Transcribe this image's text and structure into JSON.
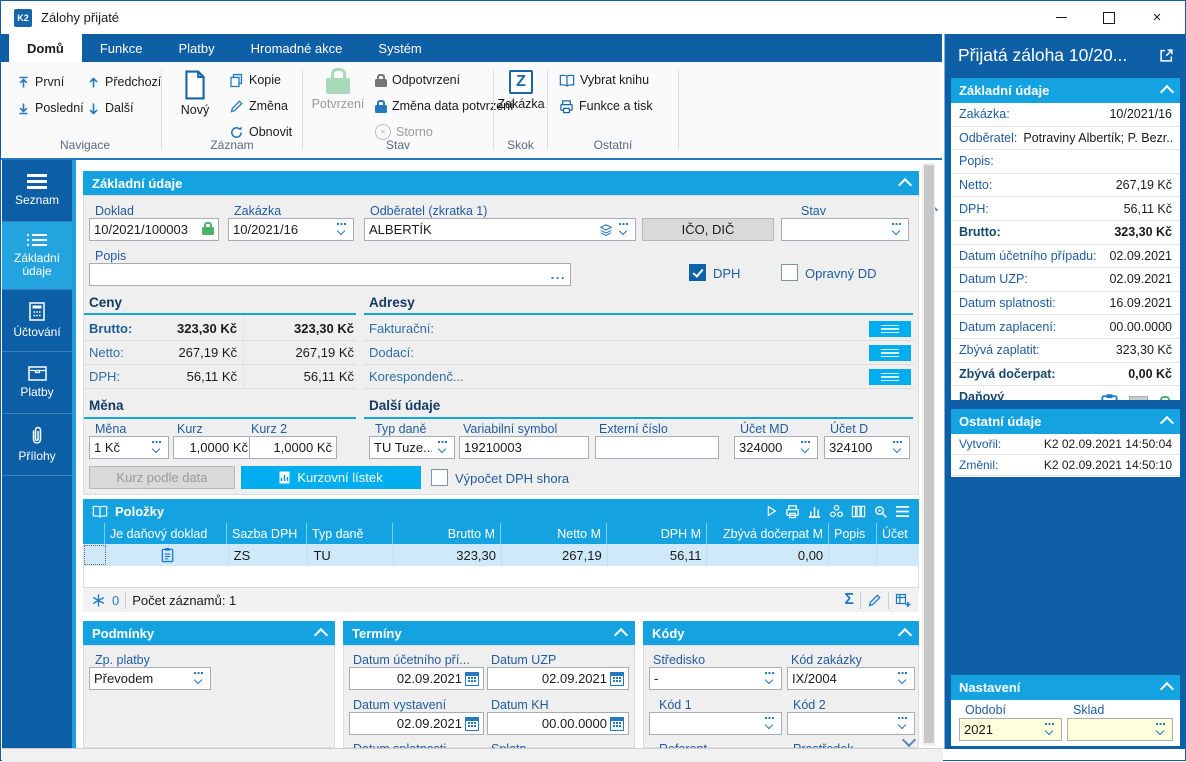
{
  "window": {
    "title": "Zálohy přijaté"
  },
  "tabs": {
    "items": [
      "Domů",
      "Funkce",
      "Platby",
      "Hromadné akce",
      "Systém"
    ],
    "active": "Domů"
  },
  "ribbon": {
    "navigace": {
      "label": "Navigace",
      "prvni": "První",
      "posledni": "Poslední",
      "predchozi": "Předchozí",
      "dalsi": "Další"
    },
    "zaznam": {
      "label": "Záznam",
      "novy": "Nový",
      "kopie": "Kopie",
      "zmena": "Změna",
      "obnovit": "Obnovit"
    },
    "stav": {
      "label": "Stav",
      "potvrzeni": "Potvrzení",
      "odpotvrzeni": "Odpotvrzení",
      "zmena_data": "Změna data potvrzení",
      "storno": "Storno"
    },
    "skok": {
      "label": "Skok",
      "zakazka": "Zakázka"
    },
    "ostatni": {
      "label": "Ostatní",
      "vybrat_knihu": "Vybrat knihu",
      "funkce_a_tisk": "Funkce a tisk"
    }
  },
  "sidebar": {
    "items": [
      {
        "label": "Seznam",
        "icon": "menu-icon"
      },
      {
        "label": "Základní údaje",
        "icon": "list-icon",
        "active": true
      },
      {
        "label": "Účtování",
        "icon": "calculator-icon"
      },
      {
        "label": "Platby",
        "icon": "drawer-icon"
      },
      {
        "label": "Přílohy",
        "icon": "paperclip-icon"
      }
    ]
  },
  "form": {
    "section_title": "Základní údaje",
    "doklad": {
      "label": "Doklad",
      "value": "10/2021/100003"
    },
    "zakazka": {
      "label": "Zakázka",
      "value": "10/2021/16"
    },
    "odberatel": {
      "label": "Odběratel (zkratka 1)",
      "value": "ALBERTÍK"
    },
    "ico_dic_button": "IČO, DIČ",
    "stav": {
      "label": "Stav",
      "value": ""
    },
    "popis": {
      "label": "Popis",
      "value": "",
      "more": "..."
    },
    "dph": {
      "label": "DPH",
      "checked": true
    },
    "opravny_dd": {
      "label": "Opravný DD",
      "checked": false
    },
    "ceny": {
      "title": "Ceny",
      "rows": [
        {
          "label": "Brutto:",
          "v1": "323,30 Kč",
          "v2": "323,30 Kč",
          "bold": true
        },
        {
          "label": "Netto:",
          "v1": "267,19 Kč",
          "v2": "267,19 Kč"
        },
        {
          "label": "DPH:",
          "v1": "56,11 Kč",
          "v2": "56,11 Kč"
        }
      ]
    },
    "adresy": {
      "title": "Adresy",
      "rows": [
        "Fakturační:",
        "Dodací:",
        "Korespondenč..."
      ]
    },
    "mena": {
      "title": "Měna",
      "mena": {
        "label": "Měna",
        "value": "1 Kč"
      },
      "kurz": {
        "label": "Kurz",
        "value": "1,0000 Kč"
      },
      "kurz2": {
        "label": "Kurz 2",
        "value": "1,0000 Kč"
      },
      "kurz_podle_data": "Kurz podle data",
      "kurzovni_listek": "Kurzovní lístek",
      "vypocet_dph": {
        "label": "Výpočet DPH shora",
        "checked": false
      }
    },
    "dalsi": {
      "title": "Další údaje",
      "typ_dane": {
        "label": "Typ daně",
        "value": "TU Tuze..."
      },
      "var_symbol": {
        "label": "Variabilní symbol",
        "value": "19210003"
      },
      "externi_cislo": {
        "label": "Externí číslo",
        "value": ""
      },
      "ucet_md": {
        "label": "Účet MD",
        "value": "324000"
      },
      "ucet_d": {
        "label": "Účet D",
        "value": "324100"
      }
    }
  },
  "polozky": {
    "title": "Položky",
    "toolbar_icons": [
      "play-icon",
      "print-icon",
      "chart-icon",
      "analysis-icon",
      "columns-icon",
      "search-settings-icon",
      "menu-icon"
    ],
    "columns": [
      "Je daňový doklad",
      "Sazba DPH",
      "Typ daně",
      "Brutto M",
      "Netto M",
      "DPH M",
      "Zbývá dočerpat M",
      "Popis",
      "Účet"
    ],
    "rows": [
      {
        "je_danovy_doklad": "clipboard-icon",
        "sazba_dph": "ZS",
        "typ_dane": "TU",
        "brutto_m": "323,30",
        "netto_m": "267,19",
        "dph_m": "56,11",
        "zbyva_docerpat_m": "0,00",
        "popis": "",
        "ucet": ""
      }
    ],
    "status": {
      "flag": "0",
      "records": "Počet záznamů: 1",
      "right_icons": [
        "sigma-icon",
        "pencil-icon",
        "table-add-icon"
      ]
    }
  },
  "podminky": {
    "title": "Podmínky",
    "zp_platby": {
      "label": "Zp. platby",
      "value": "Převodem"
    }
  },
  "terminy": {
    "title": "Termíny",
    "fields": [
      {
        "label": "Datum účetního pří...",
        "value": "02.09.2021"
      },
      {
        "label": "Datum UZP",
        "value": "02.09.2021"
      },
      {
        "label": "Datum vystavení",
        "value": "02.09.2021"
      },
      {
        "label": "Datum KH",
        "value": "00.00.0000"
      },
      {
        "label": "Datum splatnosti",
        "value": ""
      },
      {
        "label": "Splatn",
        "value": ""
      }
    ]
  },
  "kody": {
    "title": "Kódy",
    "fields": [
      {
        "label": "Středisko",
        "value": "-"
      },
      {
        "label": "Kód zakázky",
        "value": "IX/2004"
      },
      {
        "label": "Kód 1",
        "value": ""
      },
      {
        "label": "Kód 2",
        "value": ""
      },
      {
        "label": "Referent",
        "value": ""
      },
      {
        "label": "Prostředek",
        "value": ""
      }
    ]
  },
  "panel": {
    "title": "Přijatá záloha 10/20...",
    "zakladni": {
      "title": "Základní údaje",
      "rows": [
        {
          "label": "Zakázka:",
          "value": "10/2021/16"
        },
        {
          "label": "Odběratel:",
          "value": "Potraviny Albertík; P. Bezr..."
        },
        {
          "label": "Popis:",
          "value": ""
        },
        {
          "label": "Netto:",
          "value": "267,19 Kč"
        },
        {
          "label": "DPH:",
          "value": "56,11 Kč"
        },
        {
          "label": "Brutto:",
          "value": "323,30 Kč",
          "bold": true
        },
        {
          "label": "Datum účetního případu:",
          "value": "02.09.2021"
        },
        {
          "label": "Datum UZP:",
          "value": "02.09.2021"
        },
        {
          "label": "Datum splatnosti:",
          "value": "16.09.2021"
        },
        {
          "label": "Datum zaplacení:",
          "value": "00.00.0000"
        },
        {
          "label": "Zbývá zaplatit:",
          "value": "323,30 Kč"
        },
        {
          "label": "Zbývá dočerpat:",
          "value": "0,00 Kč",
          "bold": true
        },
        {
          "label": "Daňový doklad",
          "bold": true,
          "icons": [
            "clipboard-icon",
            "gray-square-icon",
            "lock-icon"
          ]
        }
      ]
    },
    "ostatni": {
      "title": "Ostatní údaje",
      "rows": [
        {
          "label": "Vytvořil:",
          "value": "K2 02.09.2021 14:50:04"
        },
        {
          "label": "Změnil:",
          "value": "K2 02.09.2021 14:50:10"
        }
      ]
    },
    "nastaveni": {
      "title": "Nastavení",
      "obdobi": {
        "label": "Období",
        "value": "2021"
      },
      "sklad": {
        "label": "Sklad",
        "value": ""
      }
    }
  },
  "colors": {
    "accent_blue": "#0E5FA6",
    "header_cyan": "#14A3E0",
    "button_cyan": "#00AEEF",
    "selected_row": "#CFE9F8",
    "confirmed_green": "#4DB26A",
    "field_yellow": "#FFFFDC"
  }
}
